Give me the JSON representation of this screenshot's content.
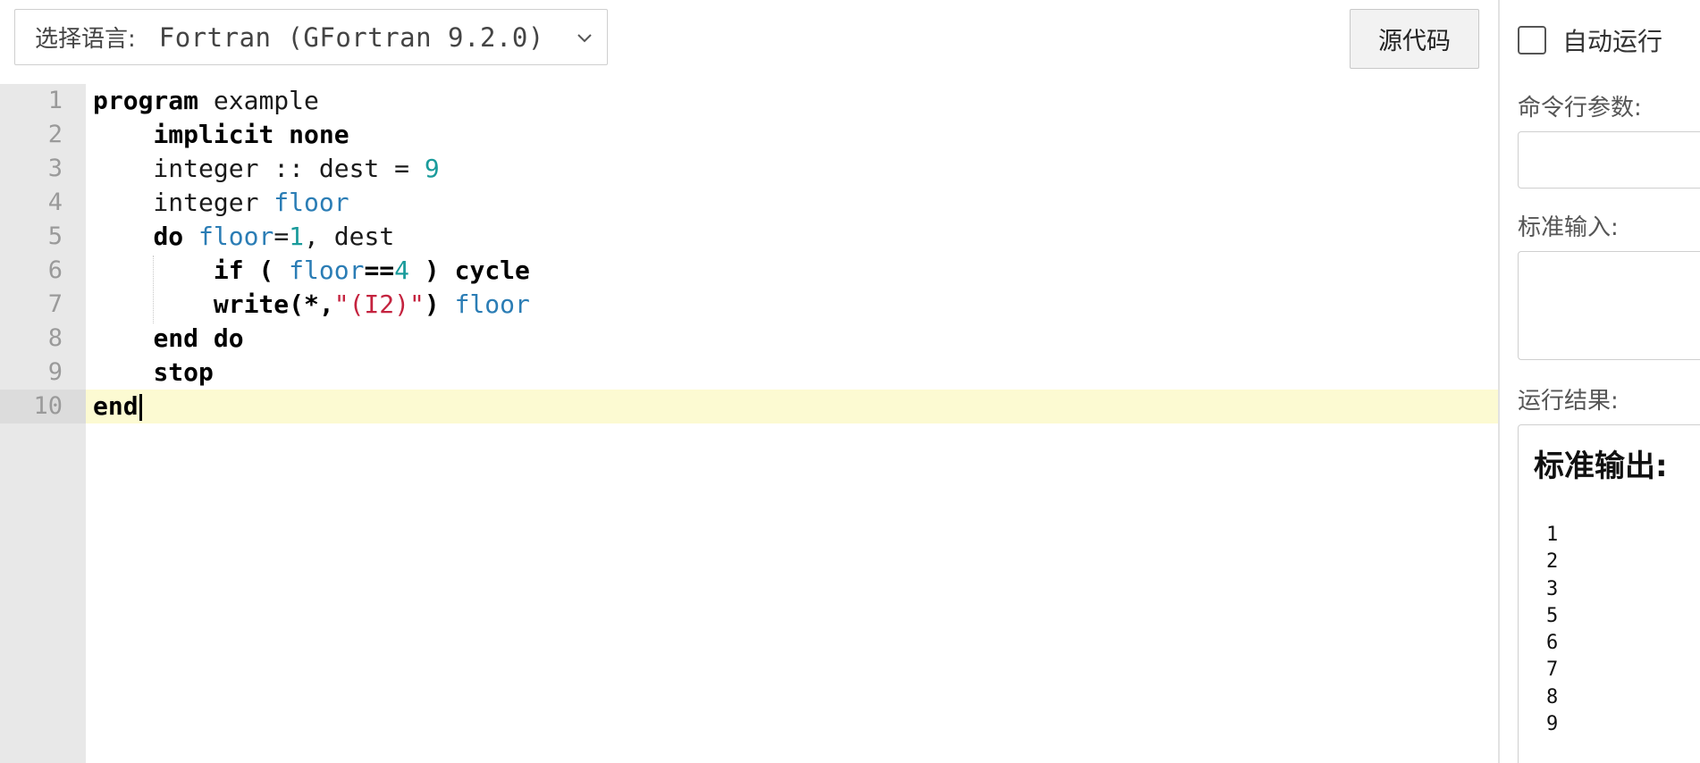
{
  "language_select": {
    "label": "选择语言:",
    "value": "Fortran (GFortran 9.2.0)"
  },
  "toolbar": {
    "source_button": "源代码"
  },
  "editor": {
    "line_numbers": [
      "1",
      "2",
      "3",
      "4",
      "5",
      "6",
      "7",
      "8",
      "9",
      "10"
    ],
    "active_line": 10,
    "lines": [
      [
        {
          "t": "program",
          "c": "kw"
        },
        {
          "t": " example",
          "c": "plain"
        }
      ],
      [
        {
          "t": "    "
        },
        {
          "t": "implicit none",
          "c": "kw"
        }
      ],
      [
        {
          "t": "    integer :: dest = ",
          "c": "plain"
        },
        {
          "t": "9",
          "c": "num"
        }
      ],
      [
        {
          "t": "    integer ",
          "c": "plain"
        },
        {
          "t": "floor",
          "c": "var"
        }
      ],
      [
        {
          "t": "    "
        },
        {
          "t": "do",
          "c": "kw"
        },
        {
          "t": " ",
          "c": "plain"
        },
        {
          "t": "floor",
          "c": "var"
        },
        {
          "t": "=",
          "c": "plain"
        },
        {
          "t": "1",
          "c": "num"
        },
        {
          "t": ", dest",
          "c": "plain"
        }
      ],
      [
        {
          "t": "        "
        },
        {
          "t": "if (",
          "c": "kw"
        },
        {
          "t": " ",
          "c": "plain"
        },
        {
          "t": "floor",
          "c": "var"
        },
        {
          "t": "==",
          "c": "kw"
        },
        {
          "t": "4",
          "c": "num"
        },
        {
          "t": " ",
          "c": "plain"
        },
        {
          "t": ") cycle",
          "c": "kw"
        }
      ],
      [
        {
          "t": "        "
        },
        {
          "t": "write(*,",
          "c": "kw"
        },
        {
          "t": "\"(I2)\"",
          "c": "str"
        },
        {
          "t": ")",
          "c": "kw"
        },
        {
          "t": " ",
          "c": "plain"
        },
        {
          "t": "floor",
          "c": "var"
        }
      ],
      [
        {
          "t": "    "
        },
        {
          "t": "end do",
          "c": "kw"
        }
      ],
      [
        {
          "t": "    "
        },
        {
          "t": "stop",
          "c": "kw"
        }
      ],
      [
        {
          "t": "end",
          "c": "kw"
        }
      ]
    ]
  },
  "panel": {
    "auto_run_label": "自动运行",
    "args_label": "命令行参数:",
    "stdin_label": "标准输入:",
    "result_label": "运行结果:",
    "stdout_title": "标准输出:",
    "stdout_lines": [
      "1",
      "2",
      "3",
      "5",
      "6",
      "7",
      "8",
      "9"
    ]
  }
}
